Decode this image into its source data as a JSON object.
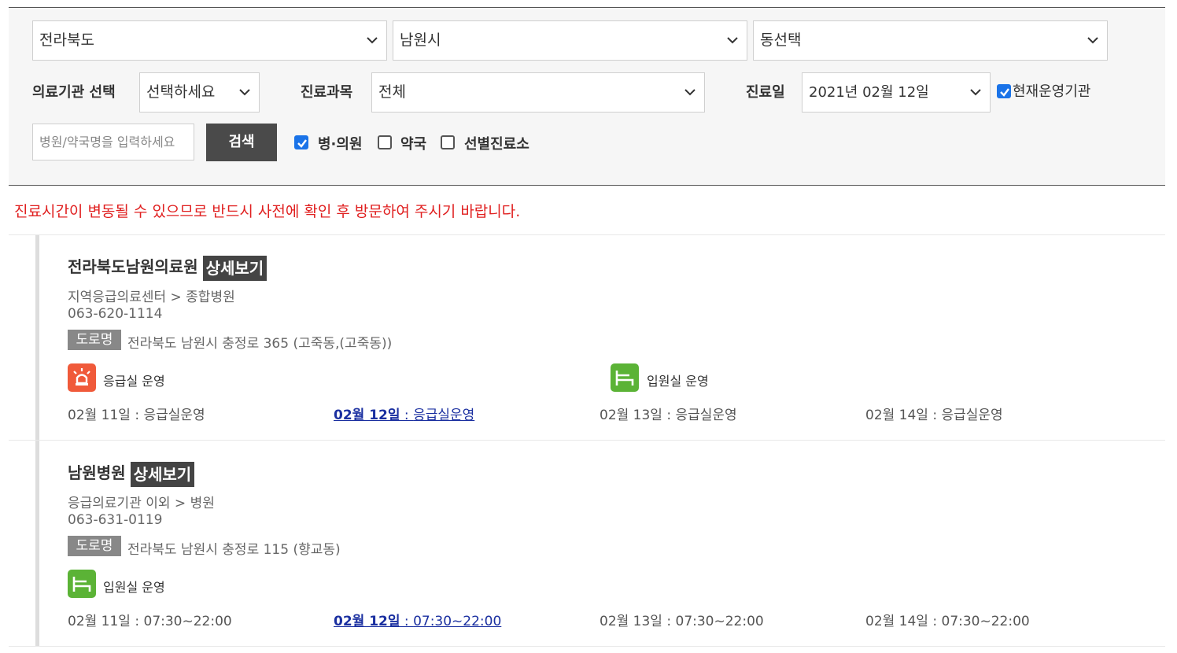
{
  "filters": {
    "province": "전라북도",
    "city": "남원시",
    "district": "동선택",
    "institution_label": "의료기관 선택",
    "institution_value": "선택하세요",
    "department_label": "진료과목",
    "department_value": "전체",
    "date_label": "진료일",
    "date_value": "2021년 02월 12일",
    "currently_operating_label": "현재운영기관",
    "search_placeholder": "병원/약국명을 입력하세요",
    "search_button": "검색",
    "type_hospital": "병·의원",
    "type_pharmacy": "약국",
    "type_screening": "선별진료소"
  },
  "notice": "진료시간이 변동될 수 있으므로 반드시 사전에 확인 후 방문하여 주시기 바랍니다.",
  "results": [
    {
      "name": "전라북도남원의료원",
      "detail_button": "상세보기",
      "type": "지역응급의료센터 > 종합병원",
      "phone": "063-620-1114",
      "road_label": "도로명",
      "address": "전라북도 남원시 충정로 365 (고죽동,(고죽동))",
      "services": [
        {
          "icon": "emergency-siren-icon",
          "label": "응급실 운영",
          "color": "#f05a3a"
        },
        {
          "icon": "hospital-bed-icon",
          "label": "입원실 운영",
          "color": "#5bb336"
        }
      ],
      "schedule": [
        {
          "date": "02월 11일",
          "value": "응급실운영",
          "today": false
        },
        {
          "date": "02월 12일",
          "value": "응급실운영",
          "today": true
        },
        {
          "date": "02월 13일",
          "value": "응급실운영",
          "today": false
        },
        {
          "date": "02월 14일",
          "value": "응급실운영",
          "today": false
        }
      ]
    },
    {
      "name": "남원병원",
      "detail_button": "상세보기",
      "type": "응급의료기관 이외 > 병원",
      "phone": "063-631-0119",
      "road_label": "도로명",
      "address": "전라북도 남원시 충정로 115 (향교동)",
      "services": [
        {
          "icon": "hospital-bed-icon",
          "label": "입원실 운영",
          "color": "#5bb336"
        }
      ],
      "schedule": [
        {
          "date": "02월 11일",
          "value": "07:30~22:00",
          "today": false
        },
        {
          "date": "02월 12일",
          "value": "07:30~22:00",
          "today": true
        },
        {
          "date": "02월 13일",
          "value": "07:30~22:00",
          "today": false
        },
        {
          "date": "02월 14일",
          "value": "07:30~22:00",
          "today": false
        }
      ]
    }
  ],
  "colors": {
    "notice": "#e02020",
    "today_link": "#1a2fa0",
    "button_bg": "#4a4a4a",
    "checkbox": "#1a73e8"
  }
}
